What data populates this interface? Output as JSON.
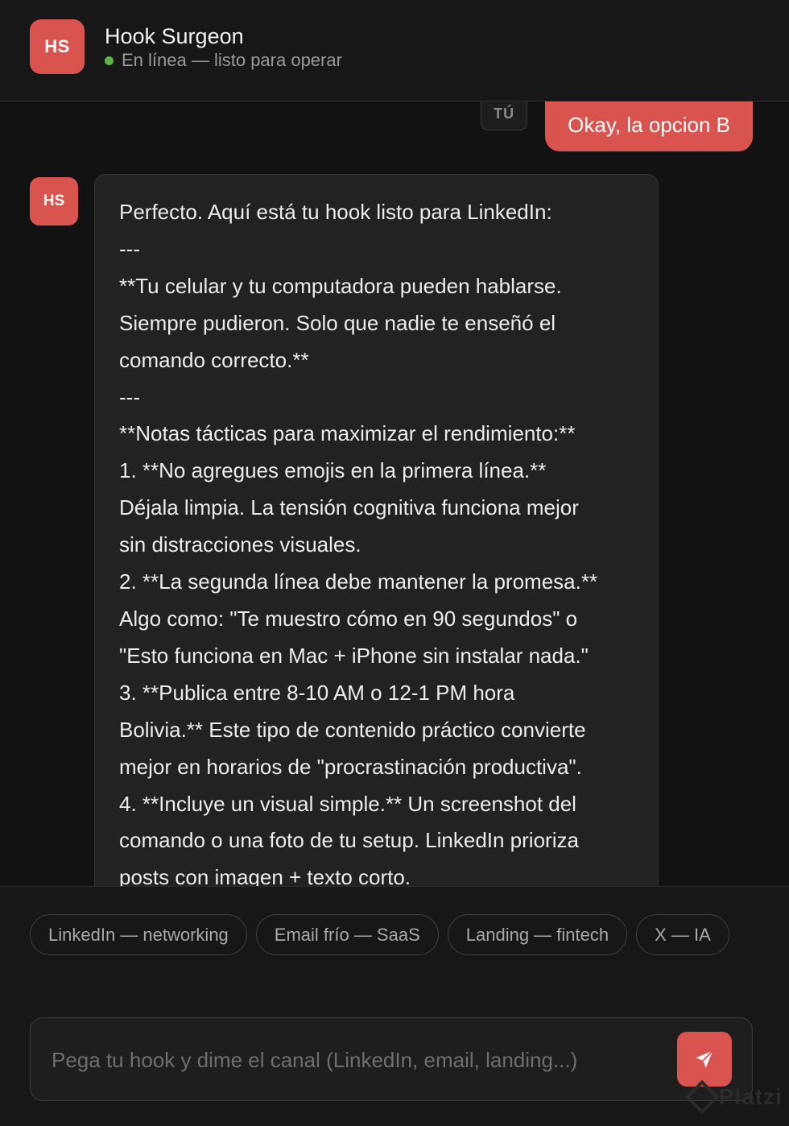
{
  "header": {
    "avatar_initials": "HS",
    "title": "Hook Surgeon",
    "status": "En línea — listo para operar",
    "status_color": "#5fb14a"
  },
  "user_message": {
    "tag": "TÚ",
    "text": "Okay, la opcion B"
  },
  "bot_message": {
    "avatar_initials": "HS",
    "lines": [
      "Perfecto. Aquí está tu hook listo para LinkedIn:",
      "---",
      "**Tu celular y tu computadora pueden hablarse.",
      "Siempre pudieron. Solo que nadie te enseñó el",
      "comando correcto.**",
      "---",
      "**Notas tácticas para maximizar el rendimiento:**",
      "1. **No agregues emojis en la primera línea.**",
      "Déjala limpia. La tensión cognitiva funciona mejor",
      "sin distracciones visuales.",
      "2. **La segunda línea debe mantener la promesa.**",
      "Algo como: \"Te muestro cómo en 90 segundos\" o",
      "\"Esto funciona en Mac + iPhone sin instalar nada.\"",
      "3. **Publica entre 8-10 AM o 12-1 PM hora",
      "Bolivia.** Este tipo de contenido práctico convierte",
      "mejor en horarios de \"procrastinación productiva\".",
      "4. **Incluye un visual simple.** Un screenshot del",
      "comando o una foto de tu setup. LinkedIn prioriza",
      "posts con imagen + texto corto."
    ]
  },
  "chips": [
    "LinkedIn — networking",
    "Email frío — SaaS",
    "Landing — fintech",
    "X — IA"
  ],
  "composer": {
    "placeholder": "Pega tu hook y dime el canal (LinkedIn, email, landing...)",
    "value": "",
    "send_icon": "send-icon"
  },
  "watermark": "Platzi",
  "colors": {
    "accent": "#d9534f",
    "background": "#121212",
    "bubble": "#222222"
  }
}
